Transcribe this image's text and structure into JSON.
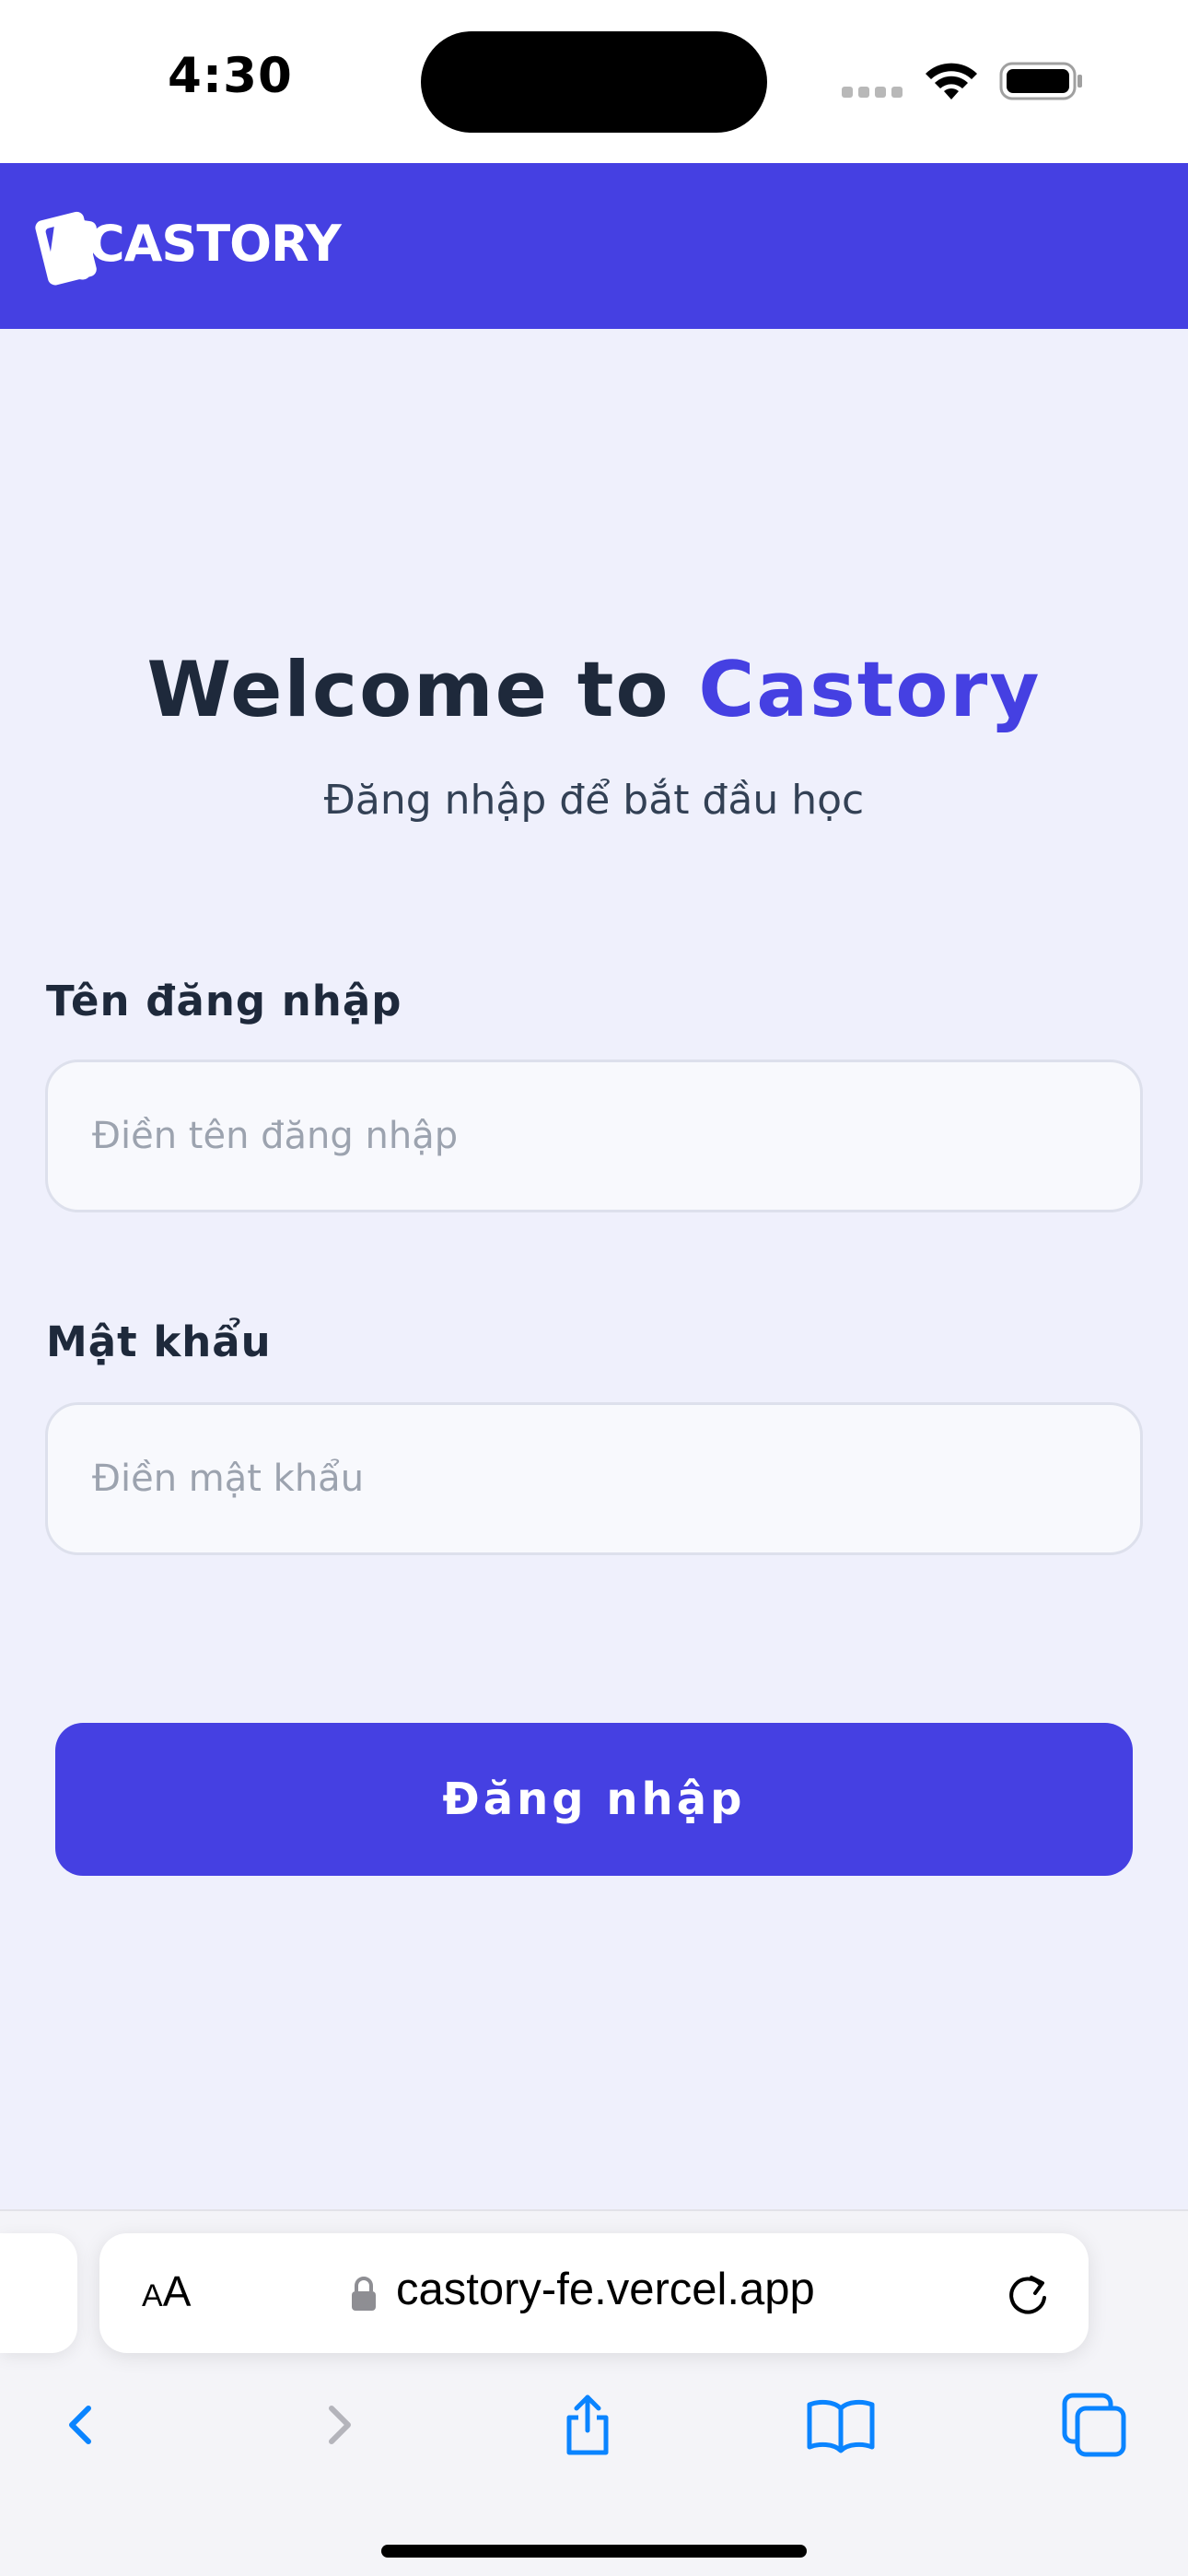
{
  "status_bar": {
    "time": "4:30"
  },
  "header": {
    "logo_text": "CASTORY",
    "brand_color": "#4540e2"
  },
  "welcome": {
    "title_prefix": "Welcome to ",
    "title_brand": "Castory",
    "subtitle": "Đăng nhập để bắt đầu học"
  },
  "form": {
    "username_label": "Tên đăng nhập",
    "username_placeholder": "Điền tên đăng nhập",
    "username_value": "",
    "password_label": "Mật khẩu",
    "password_placeholder": "Điền mật khẩu",
    "password_value": "",
    "submit_label": "Đăng nhập"
  },
  "browser": {
    "aa_small": "A",
    "aa_large": "A",
    "url": "castory-fe.vercel.app",
    "icons": {
      "lock": "lock-icon",
      "reload": "reload-icon",
      "back": "chevron-left-icon",
      "forward": "chevron-right-icon",
      "share": "share-icon",
      "bookmarks": "book-icon",
      "tabs": "tabs-icon"
    },
    "accent_color": "#0a84ff"
  }
}
